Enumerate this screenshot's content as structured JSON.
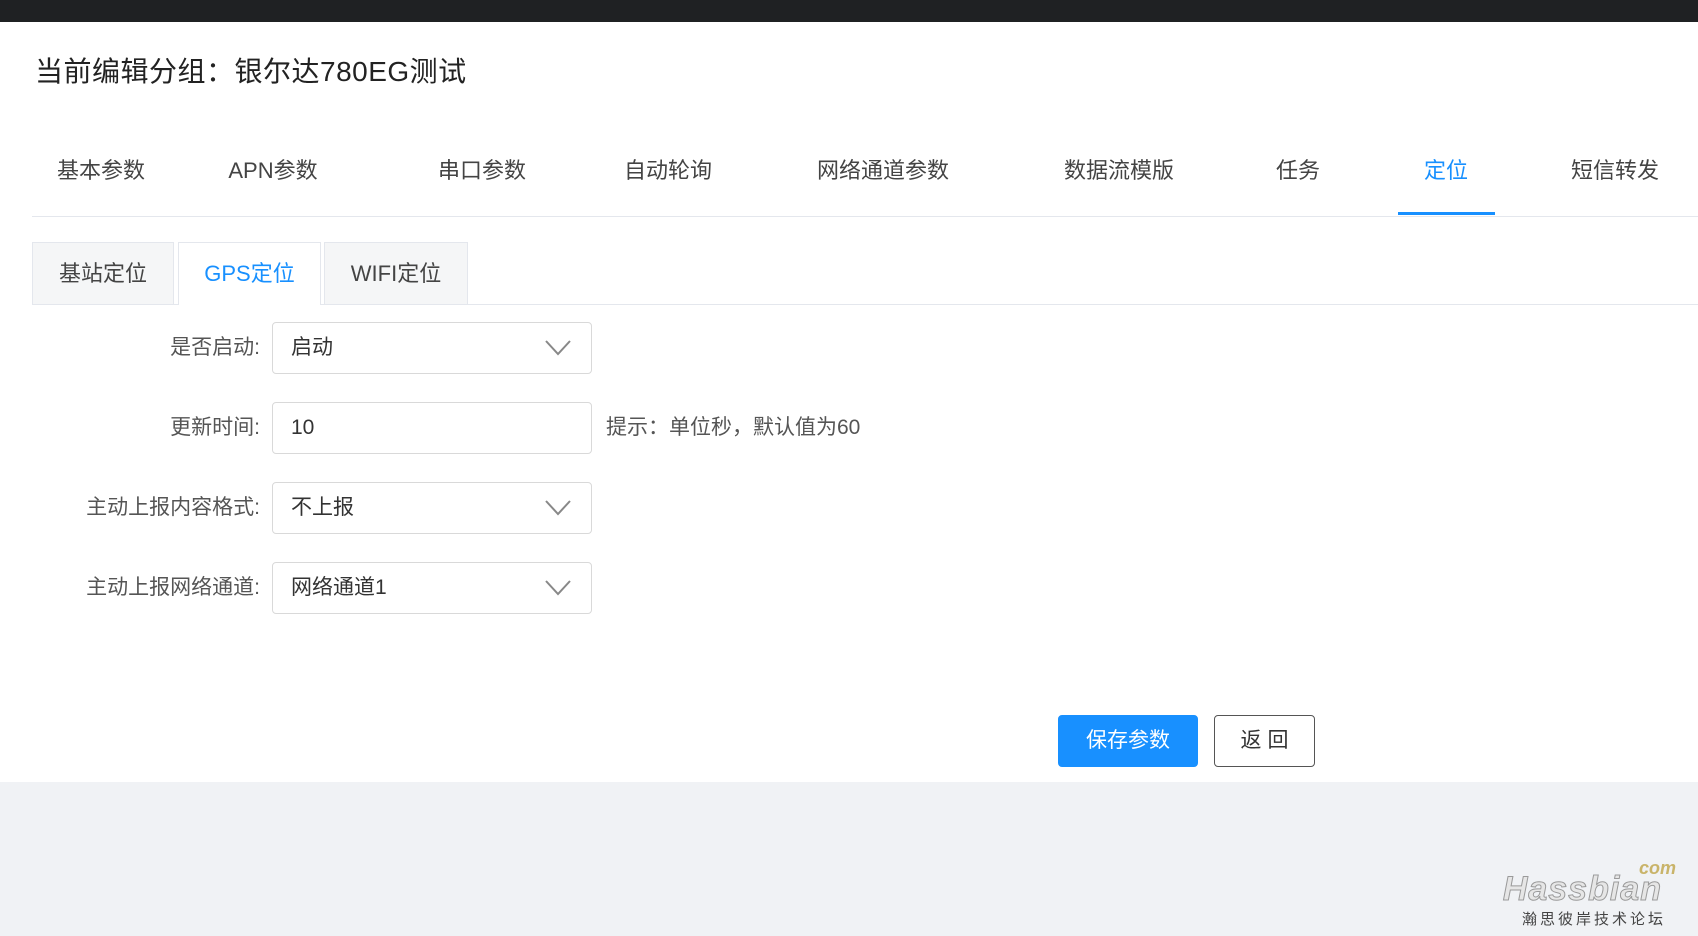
{
  "header": {
    "title": "当前编辑分组：银尔达780EG测试"
  },
  "main_tabs": [
    {
      "label": "基本参数",
      "active": false
    },
    {
      "label": "APN参数",
      "active": false
    },
    {
      "label": "串口参数",
      "active": false
    },
    {
      "label": "自动轮询",
      "active": false
    },
    {
      "label": "网络通道参数",
      "active": false
    },
    {
      "label": "数据流模版",
      "active": false
    },
    {
      "label": "任务",
      "active": false
    },
    {
      "label": "定位",
      "active": true
    },
    {
      "label": "短信转发",
      "active": false
    }
  ],
  "sub_tabs": [
    {
      "label": "基站定位",
      "active": false
    },
    {
      "label": "GPS定位",
      "active": true
    },
    {
      "label": "WIFI定位",
      "active": false
    }
  ],
  "form": {
    "enable": {
      "label": "是否启动:",
      "value": "启动"
    },
    "update_time": {
      "label": "更新时间:",
      "value": "10",
      "hint": "提示：单位秒，默认值为60"
    },
    "report_format": {
      "label": "主动上报内容格式:",
      "value": "不上报"
    },
    "report_channel": {
      "label": "主动上报网络通道:",
      "value": "网络通道1"
    }
  },
  "buttons": {
    "save": "保存参数",
    "back": "返回"
  },
  "watermark": {
    "brand": "Hassbian",
    "suffix": "com",
    "subtitle": "瀚思彼岸技术论坛"
  },
  "colors": {
    "accent": "#1890ff",
    "topbar": "#1f2123",
    "background": "#f0f2f5"
  },
  "icons": {
    "select_arrow": "chevron-down-icon"
  }
}
